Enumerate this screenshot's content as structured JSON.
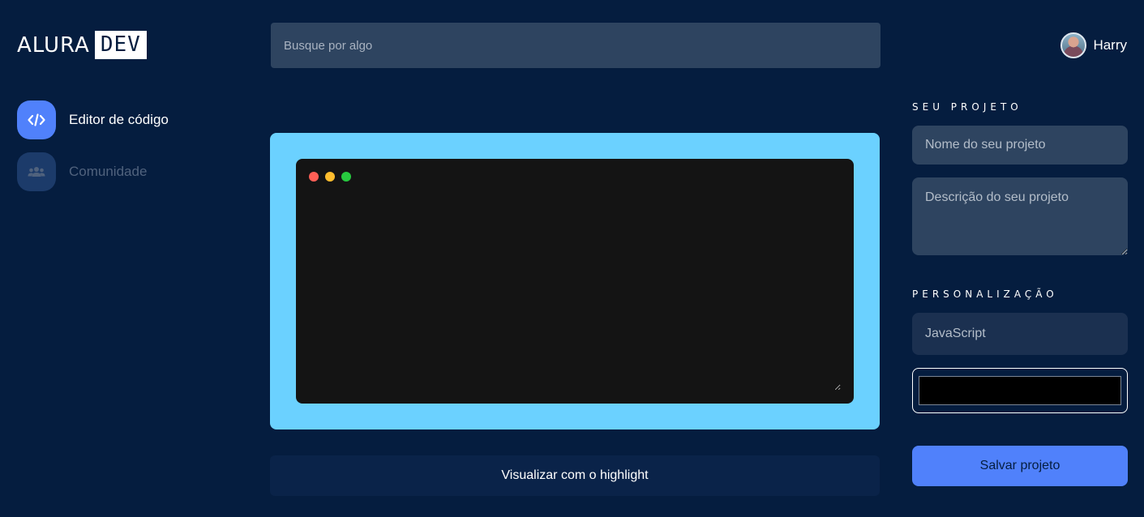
{
  "logo": {
    "part1": "ALURA",
    "part2": "DEV"
  },
  "search": {
    "placeholder": "Busque por algo",
    "value": ""
  },
  "user": {
    "name": "Harry"
  },
  "sidebar": {
    "items": [
      {
        "label": "Editor de código",
        "icon": "code-icon",
        "active": true
      },
      {
        "label": "Comunidade",
        "icon": "users-icon",
        "active": false
      }
    ]
  },
  "editor": {
    "background_color": "#6bd1ff",
    "code": ""
  },
  "highlight_button": {
    "label": "Visualizar com o highlight"
  },
  "project": {
    "section_title": "SEU PROJETO",
    "name_placeholder": "Nome do seu projeto",
    "description_placeholder": "Descrição do seu projeto"
  },
  "customization": {
    "section_title": "PERSONALIZAÇÃO",
    "language": "JavaScript",
    "color": "#000000"
  },
  "save_button": {
    "label": "Salvar projeto"
  },
  "colors": {
    "background": "#051d3f",
    "accent": "#5081fb",
    "editor_frame": "#6bd1ff"
  }
}
